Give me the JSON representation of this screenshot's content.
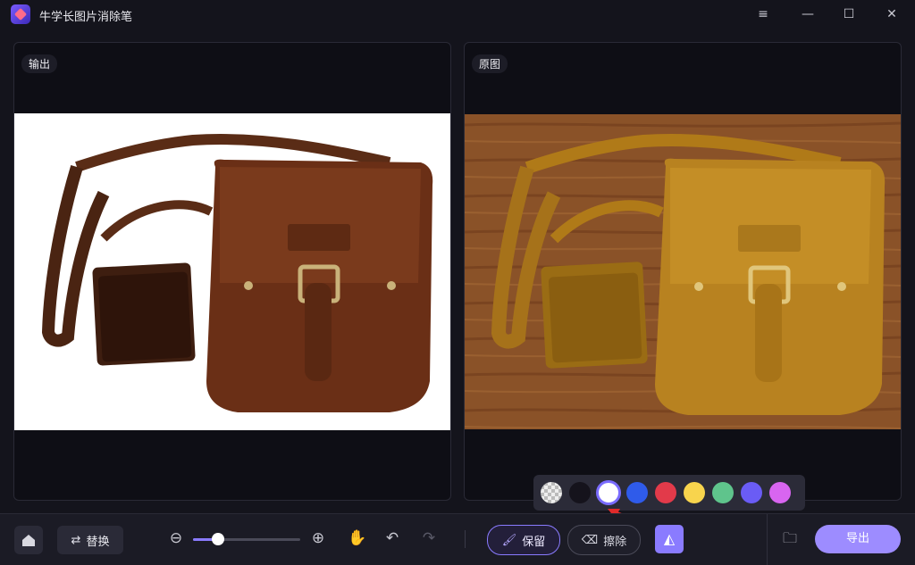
{
  "app": {
    "title": "牛学长图片消除笔"
  },
  "panels": {
    "output_label": "输出",
    "original_label": "原图"
  },
  "toolbar": {
    "replace_label": "替换",
    "keep_label": "保留",
    "erase_label": "擦除",
    "export_label": "导出",
    "zoom_level": 0.23
  },
  "palette": {
    "colors": [
      "transparent",
      "#15131c",
      "#ffffff",
      "#2f5bea",
      "#e23a4a",
      "#f8d44d",
      "#5fc48c",
      "#6a5cf5",
      "#d865f0"
    ],
    "selected_index": 2
  },
  "colors": {
    "accent": "#8a7bff",
    "bg": "#14141c",
    "panel": "#0e0e15"
  }
}
